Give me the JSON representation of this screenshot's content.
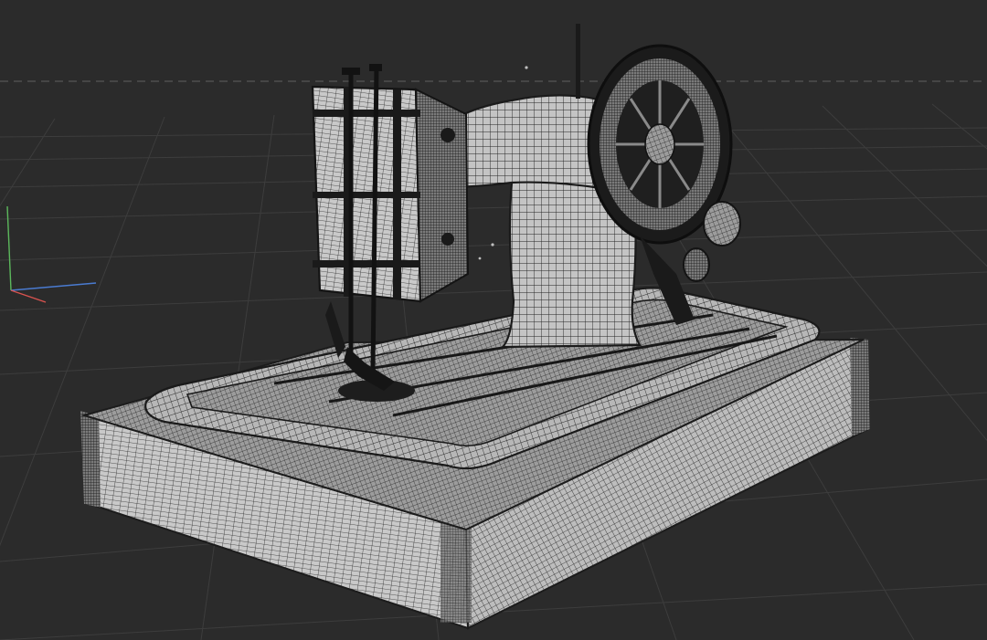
{
  "viewport": {
    "background": "#2b2b2b",
    "grid_color": "#3f3f3f",
    "horizon_color": "#5a5a5a",
    "mesh_fill": "#b9b9b9",
    "mesh_dark": "#1e1e1e",
    "wire_color": "#202020"
  },
  "axis_gizmo": {
    "x_color": "#d9534f",
    "y_color": "#5cb85c",
    "z_color": "#4a7bd1"
  },
  "model": {
    "subject": "sewing machine",
    "view": "wireframe-on-shaded"
  }
}
